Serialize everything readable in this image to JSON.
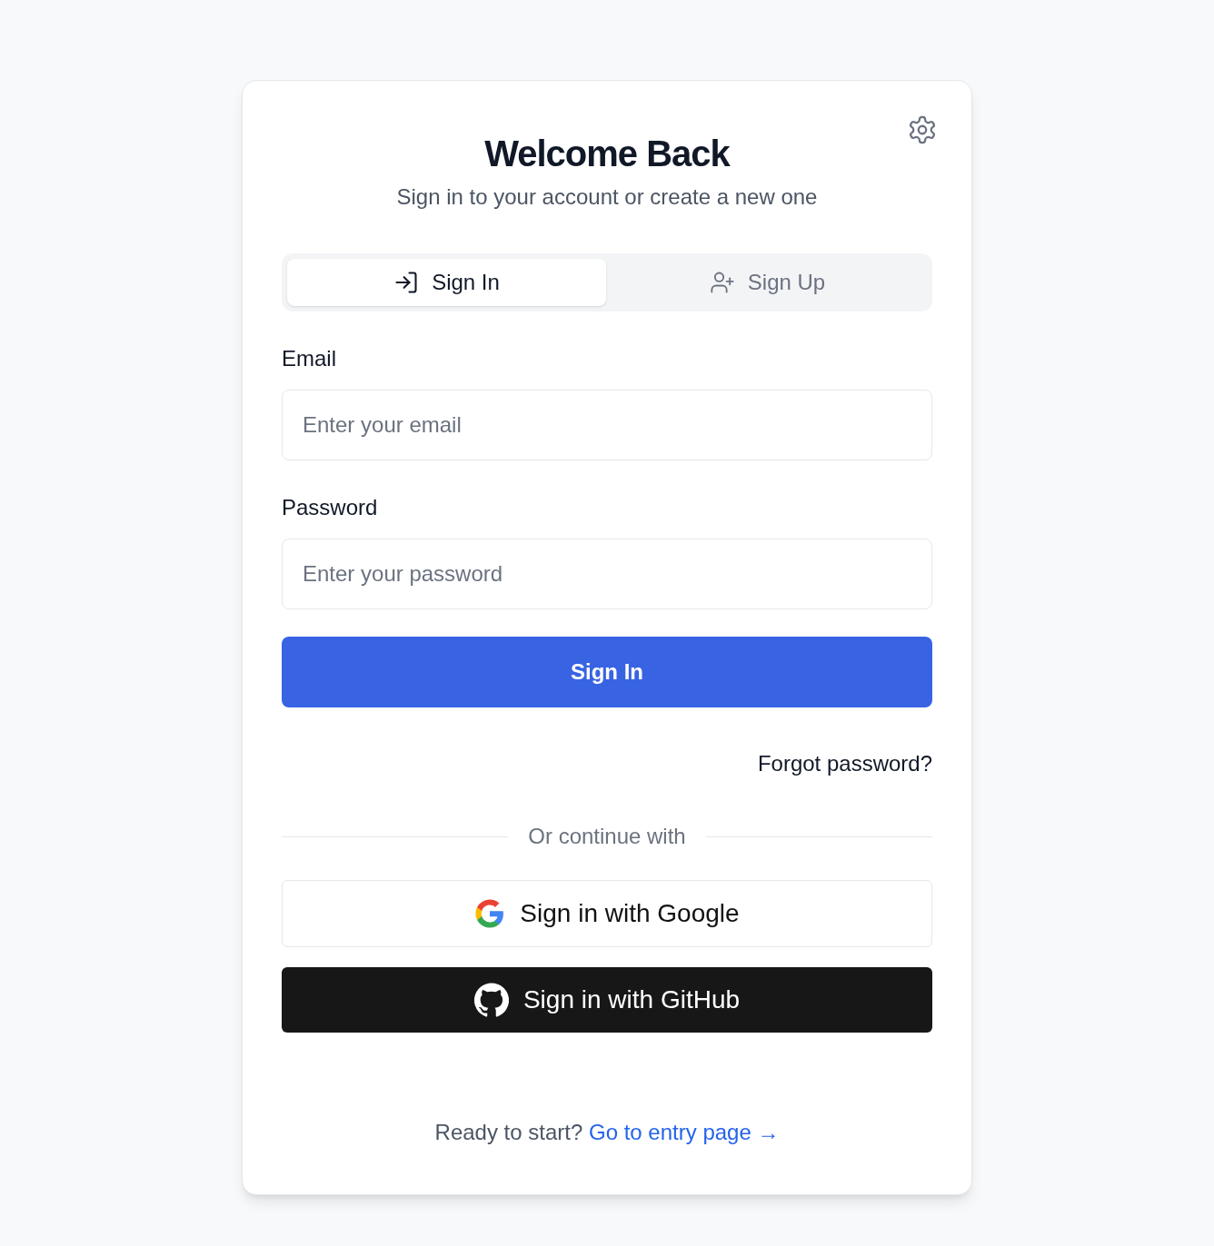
{
  "title": "Welcome Back",
  "subtitle": "Sign in to your account or create a new one",
  "tabs": [
    {
      "label": "Sign In",
      "selected": true
    },
    {
      "label": "Sign Up",
      "selected": false
    }
  ],
  "fields": [
    {
      "label": "Email",
      "placeholder": "Enter your email"
    },
    {
      "label": "Password",
      "placeholder": "Enter your password"
    }
  ],
  "submit": "Sign In",
  "forgot": "Forgot password?",
  "divider": "Or continue with",
  "social": [
    {
      "kind": "google",
      "label": "Sign in with Google"
    },
    {
      "kind": "github",
      "label": "Sign in with GitHub"
    }
  ],
  "footer": {
    "text": "Ready to start?",
    "link": "Go to entry page →"
  }
}
